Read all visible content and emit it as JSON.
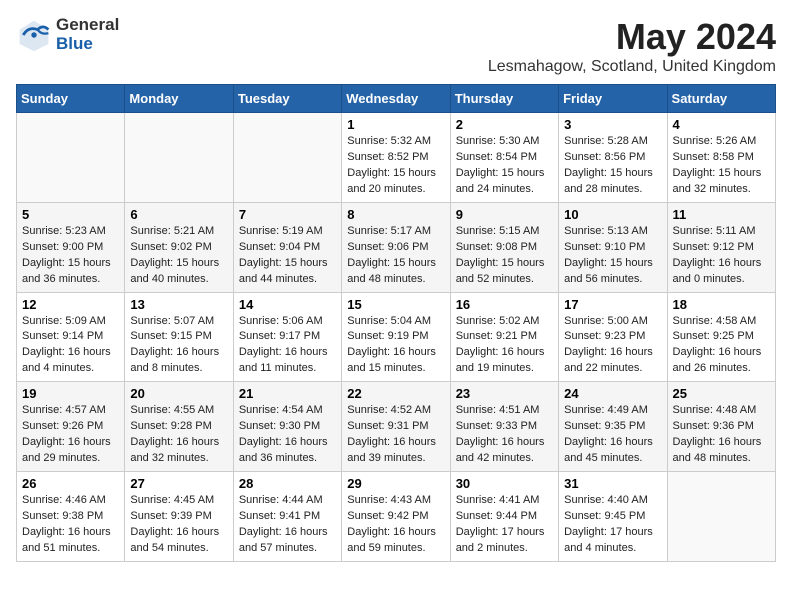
{
  "header": {
    "logo_general": "General",
    "logo_blue": "Blue",
    "title": "May 2024",
    "subtitle": "Lesmahagow, Scotland, United Kingdom"
  },
  "days_of_week": [
    "Sunday",
    "Monday",
    "Tuesday",
    "Wednesday",
    "Thursday",
    "Friday",
    "Saturday"
  ],
  "weeks": [
    [
      {
        "day": "",
        "info": ""
      },
      {
        "day": "",
        "info": ""
      },
      {
        "day": "",
        "info": ""
      },
      {
        "day": "1",
        "info": "Sunrise: 5:32 AM\nSunset: 8:52 PM\nDaylight: 15 hours\nand 20 minutes."
      },
      {
        "day": "2",
        "info": "Sunrise: 5:30 AM\nSunset: 8:54 PM\nDaylight: 15 hours\nand 24 minutes."
      },
      {
        "day": "3",
        "info": "Sunrise: 5:28 AM\nSunset: 8:56 PM\nDaylight: 15 hours\nand 28 minutes."
      },
      {
        "day": "4",
        "info": "Sunrise: 5:26 AM\nSunset: 8:58 PM\nDaylight: 15 hours\nand 32 minutes."
      }
    ],
    [
      {
        "day": "5",
        "info": "Sunrise: 5:23 AM\nSunset: 9:00 PM\nDaylight: 15 hours\nand 36 minutes."
      },
      {
        "day": "6",
        "info": "Sunrise: 5:21 AM\nSunset: 9:02 PM\nDaylight: 15 hours\nand 40 minutes."
      },
      {
        "day": "7",
        "info": "Sunrise: 5:19 AM\nSunset: 9:04 PM\nDaylight: 15 hours\nand 44 minutes."
      },
      {
        "day": "8",
        "info": "Sunrise: 5:17 AM\nSunset: 9:06 PM\nDaylight: 15 hours\nand 48 minutes."
      },
      {
        "day": "9",
        "info": "Sunrise: 5:15 AM\nSunset: 9:08 PM\nDaylight: 15 hours\nand 52 minutes."
      },
      {
        "day": "10",
        "info": "Sunrise: 5:13 AM\nSunset: 9:10 PM\nDaylight: 15 hours\nand 56 minutes."
      },
      {
        "day": "11",
        "info": "Sunrise: 5:11 AM\nSunset: 9:12 PM\nDaylight: 16 hours\nand 0 minutes."
      }
    ],
    [
      {
        "day": "12",
        "info": "Sunrise: 5:09 AM\nSunset: 9:14 PM\nDaylight: 16 hours\nand 4 minutes."
      },
      {
        "day": "13",
        "info": "Sunrise: 5:07 AM\nSunset: 9:15 PM\nDaylight: 16 hours\nand 8 minutes."
      },
      {
        "day": "14",
        "info": "Sunrise: 5:06 AM\nSunset: 9:17 PM\nDaylight: 16 hours\nand 11 minutes."
      },
      {
        "day": "15",
        "info": "Sunrise: 5:04 AM\nSunset: 9:19 PM\nDaylight: 16 hours\nand 15 minutes."
      },
      {
        "day": "16",
        "info": "Sunrise: 5:02 AM\nSunset: 9:21 PM\nDaylight: 16 hours\nand 19 minutes."
      },
      {
        "day": "17",
        "info": "Sunrise: 5:00 AM\nSunset: 9:23 PM\nDaylight: 16 hours\nand 22 minutes."
      },
      {
        "day": "18",
        "info": "Sunrise: 4:58 AM\nSunset: 9:25 PM\nDaylight: 16 hours\nand 26 minutes."
      }
    ],
    [
      {
        "day": "19",
        "info": "Sunrise: 4:57 AM\nSunset: 9:26 PM\nDaylight: 16 hours\nand 29 minutes."
      },
      {
        "day": "20",
        "info": "Sunrise: 4:55 AM\nSunset: 9:28 PM\nDaylight: 16 hours\nand 32 minutes."
      },
      {
        "day": "21",
        "info": "Sunrise: 4:54 AM\nSunset: 9:30 PM\nDaylight: 16 hours\nand 36 minutes."
      },
      {
        "day": "22",
        "info": "Sunrise: 4:52 AM\nSunset: 9:31 PM\nDaylight: 16 hours\nand 39 minutes."
      },
      {
        "day": "23",
        "info": "Sunrise: 4:51 AM\nSunset: 9:33 PM\nDaylight: 16 hours\nand 42 minutes."
      },
      {
        "day": "24",
        "info": "Sunrise: 4:49 AM\nSunset: 9:35 PM\nDaylight: 16 hours\nand 45 minutes."
      },
      {
        "day": "25",
        "info": "Sunrise: 4:48 AM\nSunset: 9:36 PM\nDaylight: 16 hours\nand 48 minutes."
      }
    ],
    [
      {
        "day": "26",
        "info": "Sunrise: 4:46 AM\nSunset: 9:38 PM\nDaylight: 16 hours\nand 51 minutes."
      },
      {
        "day": "27",
        "info": "Sunrise: 4:45 AM\nSunset: 9:39 PM\nDaylight: 16 hours\nand 54 minutes."
      },
      {
        "day": "28",
        "info": "Sunrise: 4:44 AM\nSunset: 9:41 PM\nDaylight: 16 hours\nand 57 minutes."
      },
      {
        "day": "29",
        "info": "Sunrise: 4:43 AM\nSunset: 9:42 PM\nDaylight: 16 hours\nand 59 minutes."
      },
      {
        "day": "30",
        "info": "Sunrise: 4:41 AM\nSunset: 9:44 PM\nDaylight: 17 hours\nand 2 minutes."
      },
      {
        "day": "31",
        "info": "Sunrise: 4:40 AM\nSunset: 9:45 PM\nDaylight: 17 hours\nand 4 minutes."
      },
      {
        "day": "",
        "info": ""
      }
    ]
  ]
}
